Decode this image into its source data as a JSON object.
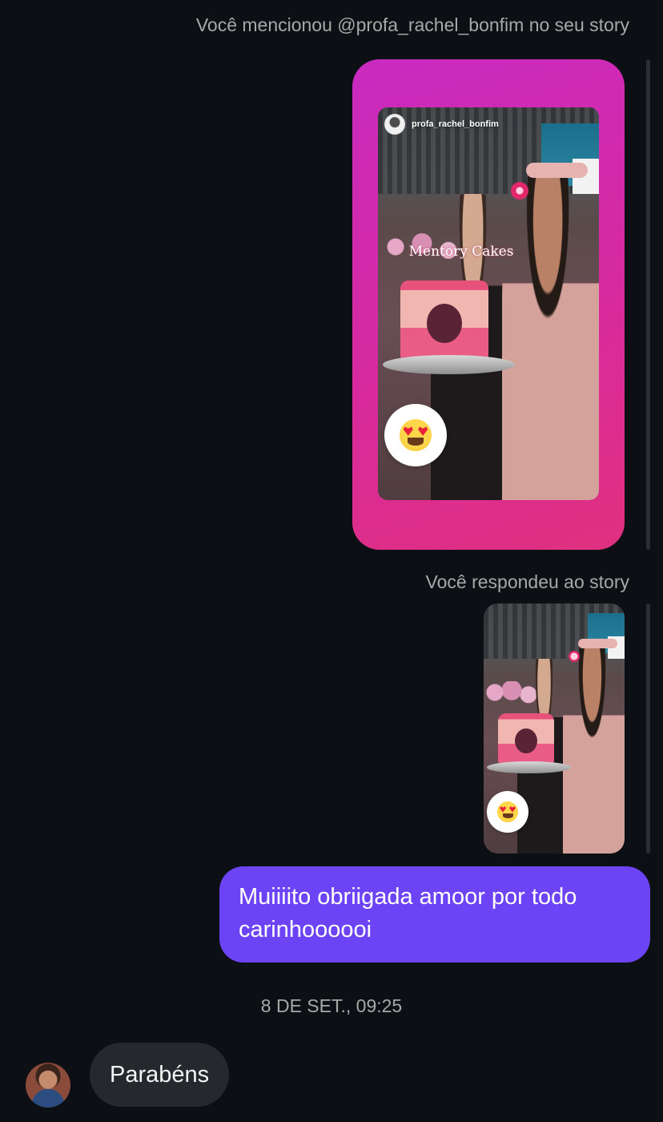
{
  "mention": {
    "label": "Você mencionou @profa_rachel_bonfim no seu story",
    "story_username": "profa_rachel_bonfim",
    "topper_text": "Mentory Cakes",
    "reaction_icon": "heart-eyes-emoji",
    "background": "#d72a9e"
  },
  "reply": {
    "label": "Você respondeu ao story",
    "reaction_icon": "heart-eyes-emoji"
  },
  "messages": {
    "outgoing": {
      "text": "Muiiiito obriigada amoor por todo carinhoooooi",
      "color": "#6d44f5"
    },
    "timestamp": "8 DE SET., 09:25",
    "incoming": {
      "text": "Parabéns",
      "color": "#25292e"
    }
  }
}
